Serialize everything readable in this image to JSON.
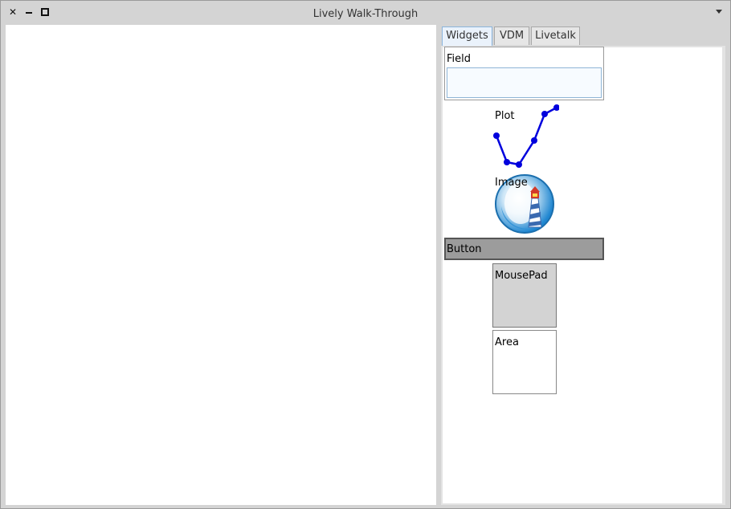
{
  "window": {
    "title": "Lively Walk-Through",
    "controls": {
      "close_icon": "close-icon",
      "minimize_icon": "minimize-icon",
      "maximize_icon": "maximize-icon",
      "menu_icon": "chevron-down-icon"
    }
  },
  "tabs": [
    {
      "label": "Widgets",
      "active": true
    },
    {
      "label": "VDM",
      "active": false
    },
    {
      "label": "Livetalk",
      "active": false
    }
  ],
  "widgets": {
    "field": {
      "label": "Field"
    },
    "plot": {
      "label": "Plot",
      "line_color": "#0000dd",
      "points": [
        [
          0,
          35
        ],
        [
          13,
          68
        ],
        [
          28,
          71
        ],
        [
          47,
          41
        ],
        [
          60,
          8
        ],
        [
          75,
          0
        ]
      ]
    },
    "image": {
      "label": "Image",
      "icon": "lighthouse-icon"
    },
    "button": {
      "label": "Button"
    },
    "mousepad": {
      "label": "MousePad"
    },
    "area": {
      "label": "Area"
    }
  },
  "colors": {
    "chrome": "#d4d4d4",
    "button_fill": "#9c9c9c",
    "mousepad_fill": "#d3d3d3",
    "active_tab": "#eaf2fb"
  }
}
